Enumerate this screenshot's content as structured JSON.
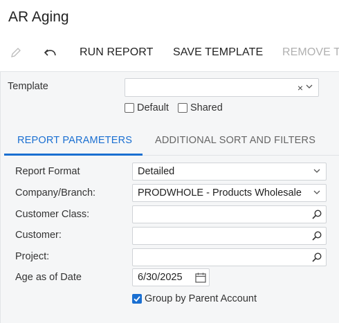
{
  "page": {
    "title": "AR Aging"
  },
  "toolbar": {
    "edit_icon": "pencil-icon",
    "undo_icon": "undo-icon",
    "run_report": "RUN REPORT",
    "save_template": "SAVE TEMPLATE",
    "remove_template": "REMOVE T"
  },
  "template": {
    "label": "Template",
    "value": "",
    "clear_glyph": "×",
    "default_label": "Default",
    "default_checked": false,
    "shared_label": "Shared",
    "shared_checked": false
  },
  "tabs": [
    {
      "label": "REPORT PARAMETERS",
      "active": true
    },
    {
      "label": "ADDITIONAL SORT AND FILTERS",
      "active": false
    }
  ],
  "params": {
    "report_format": {
      "label": "Report Format",
      "value": "Detailed"
    },
    "company_branch": {
      "label": "Company/Branch:",
      "value": "PRODWHOLE - Products Wholesale"
    },
    "customer_class": {
      "label": "Customer Class:",
      "value": ""
    },
    "customer": {
      "label": "Customer:",
      "value": ""
    },
    "project": {
      "label": "Project:",
      "value": ""
    },
    "age_as_of_date": {
      "label": "Age as of Date",
      "value": "6/30/2025"
    },
    "group_by_parent": {
      "label": "Group by Parent Account",
      "checked": true
    }
  },
  "colors": {
    "accent": "#1a6fd1",
    "panel_bg": "#f5f6f7",
    "disabled_text": "#b0b0b0"
  }
}
